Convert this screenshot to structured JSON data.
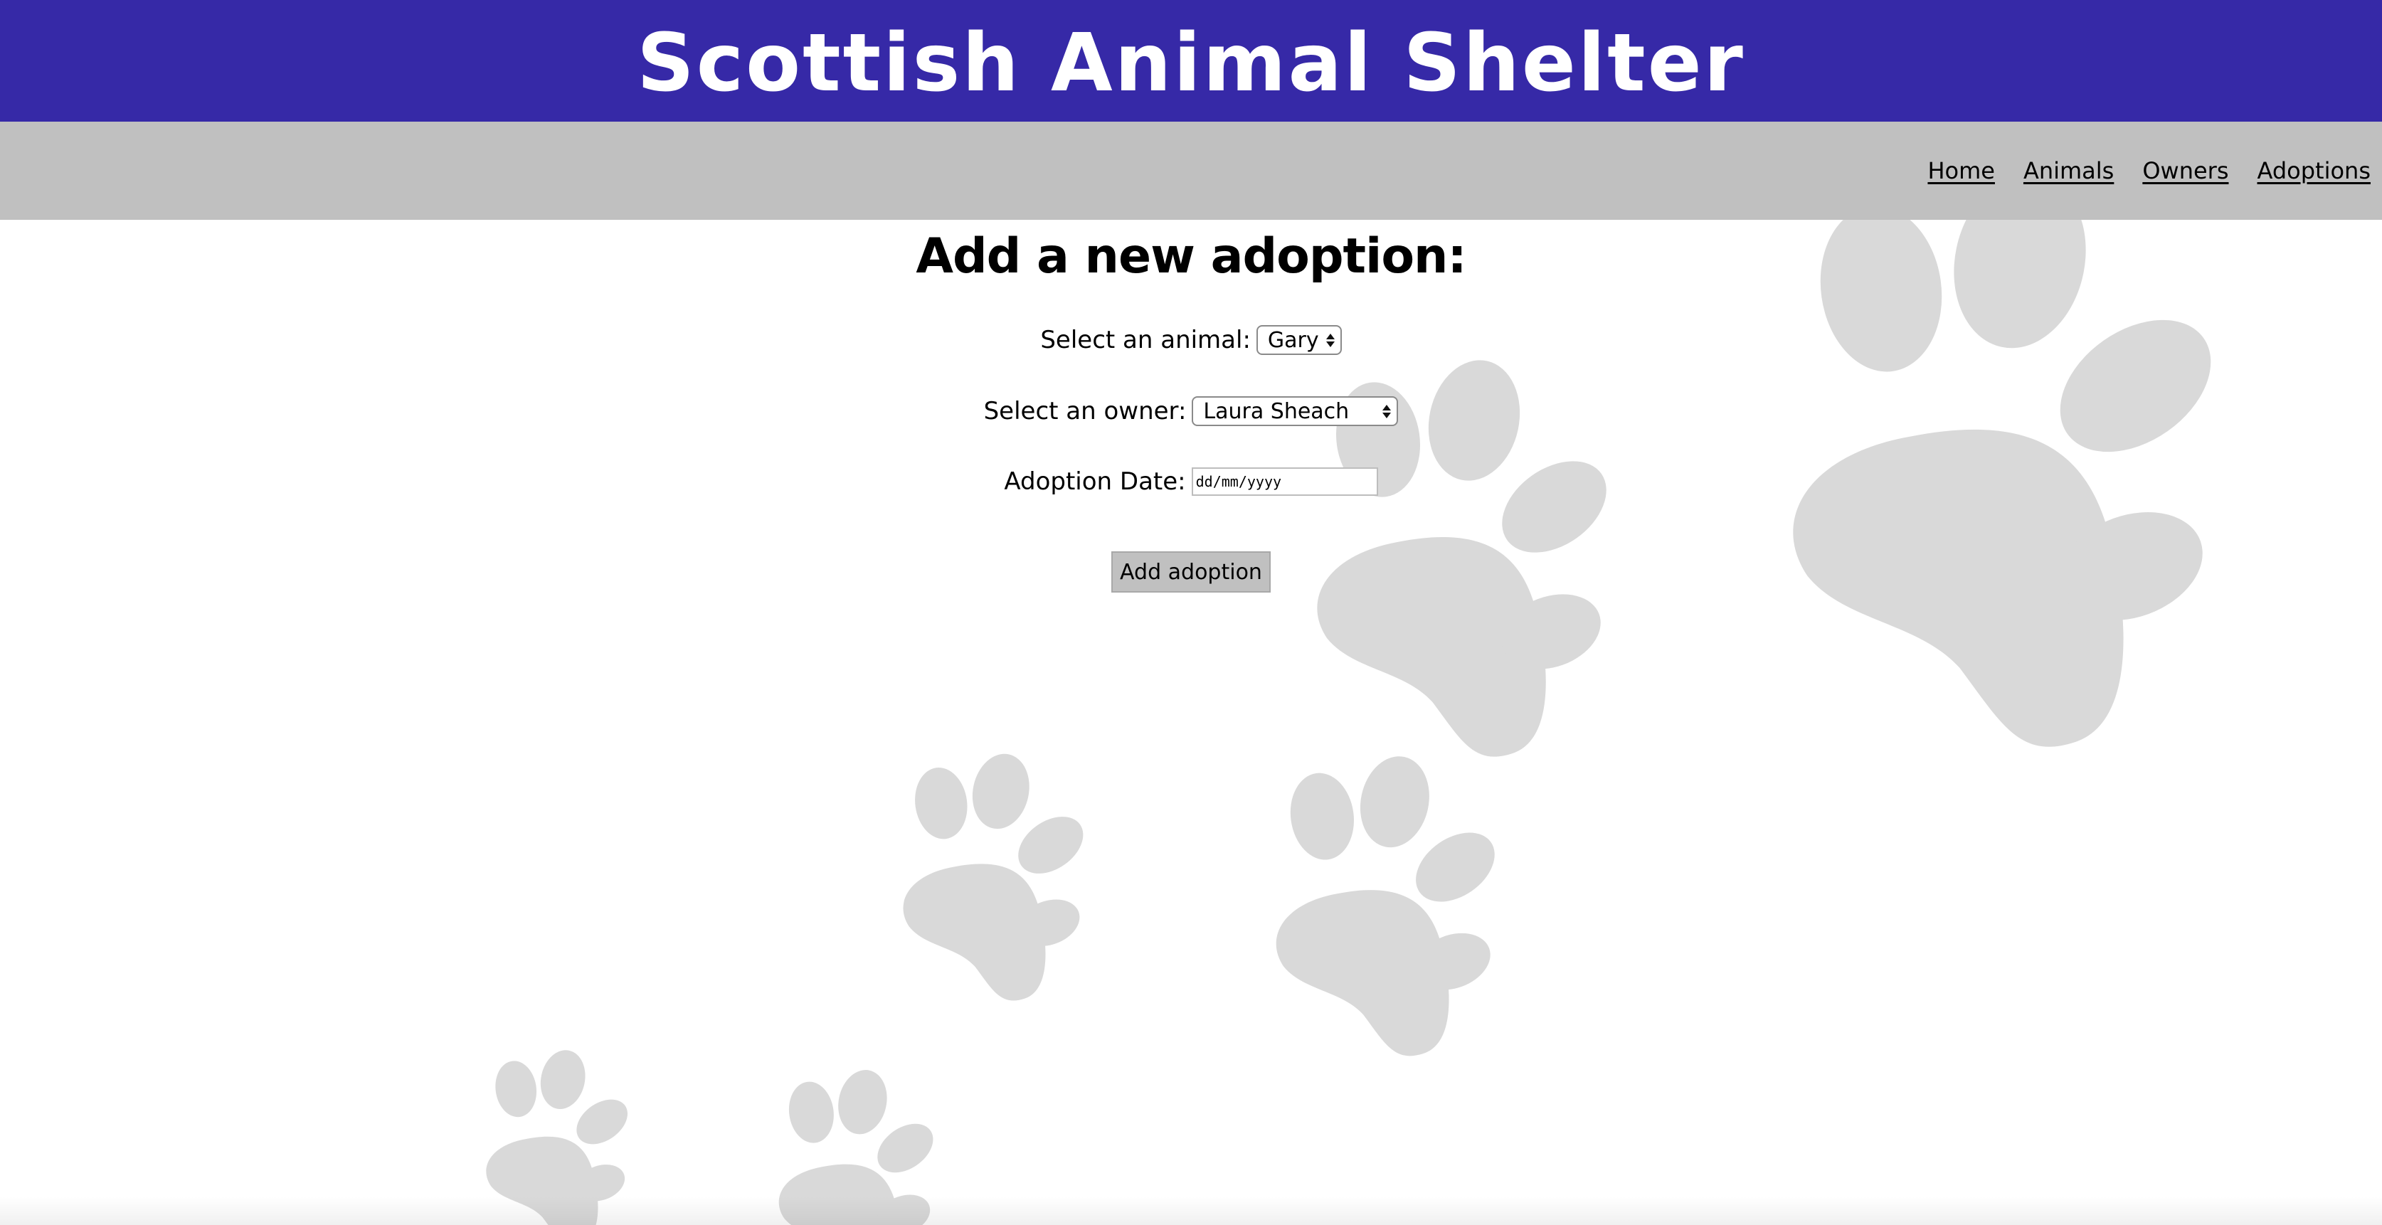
{
  "header": {
    "title": "Scottish Animal Shelter",
    "background_color": "#3629a7"
  },
  "nav": {
    "background_color": "#c0c0c0",
    "items": [
      {
        "label": "Home"
      },
      {
        "label": "Animals"
      },
      {
        "label": "Owners"
      },
      {
        "label": "Adoptions"
      }
    ]
  },
  "background": {
    "icon": "paw-print-icon",
    "color": "#d9d9d9"
  },
  "form": {
    "title": "Add a new adoption:",
    "animal_label": "Select an animal:",
    "animal_selected": "Gary",
    "owner_label": "Select an owner:",
    "owner_selected": "Laura Sheach",
    "date_label": "Adoption Date:",
    "date_placeholder": "dd/mm/yyyy",
    "date_value": "",
    "submit_label": "Add adoption"
  }
}
